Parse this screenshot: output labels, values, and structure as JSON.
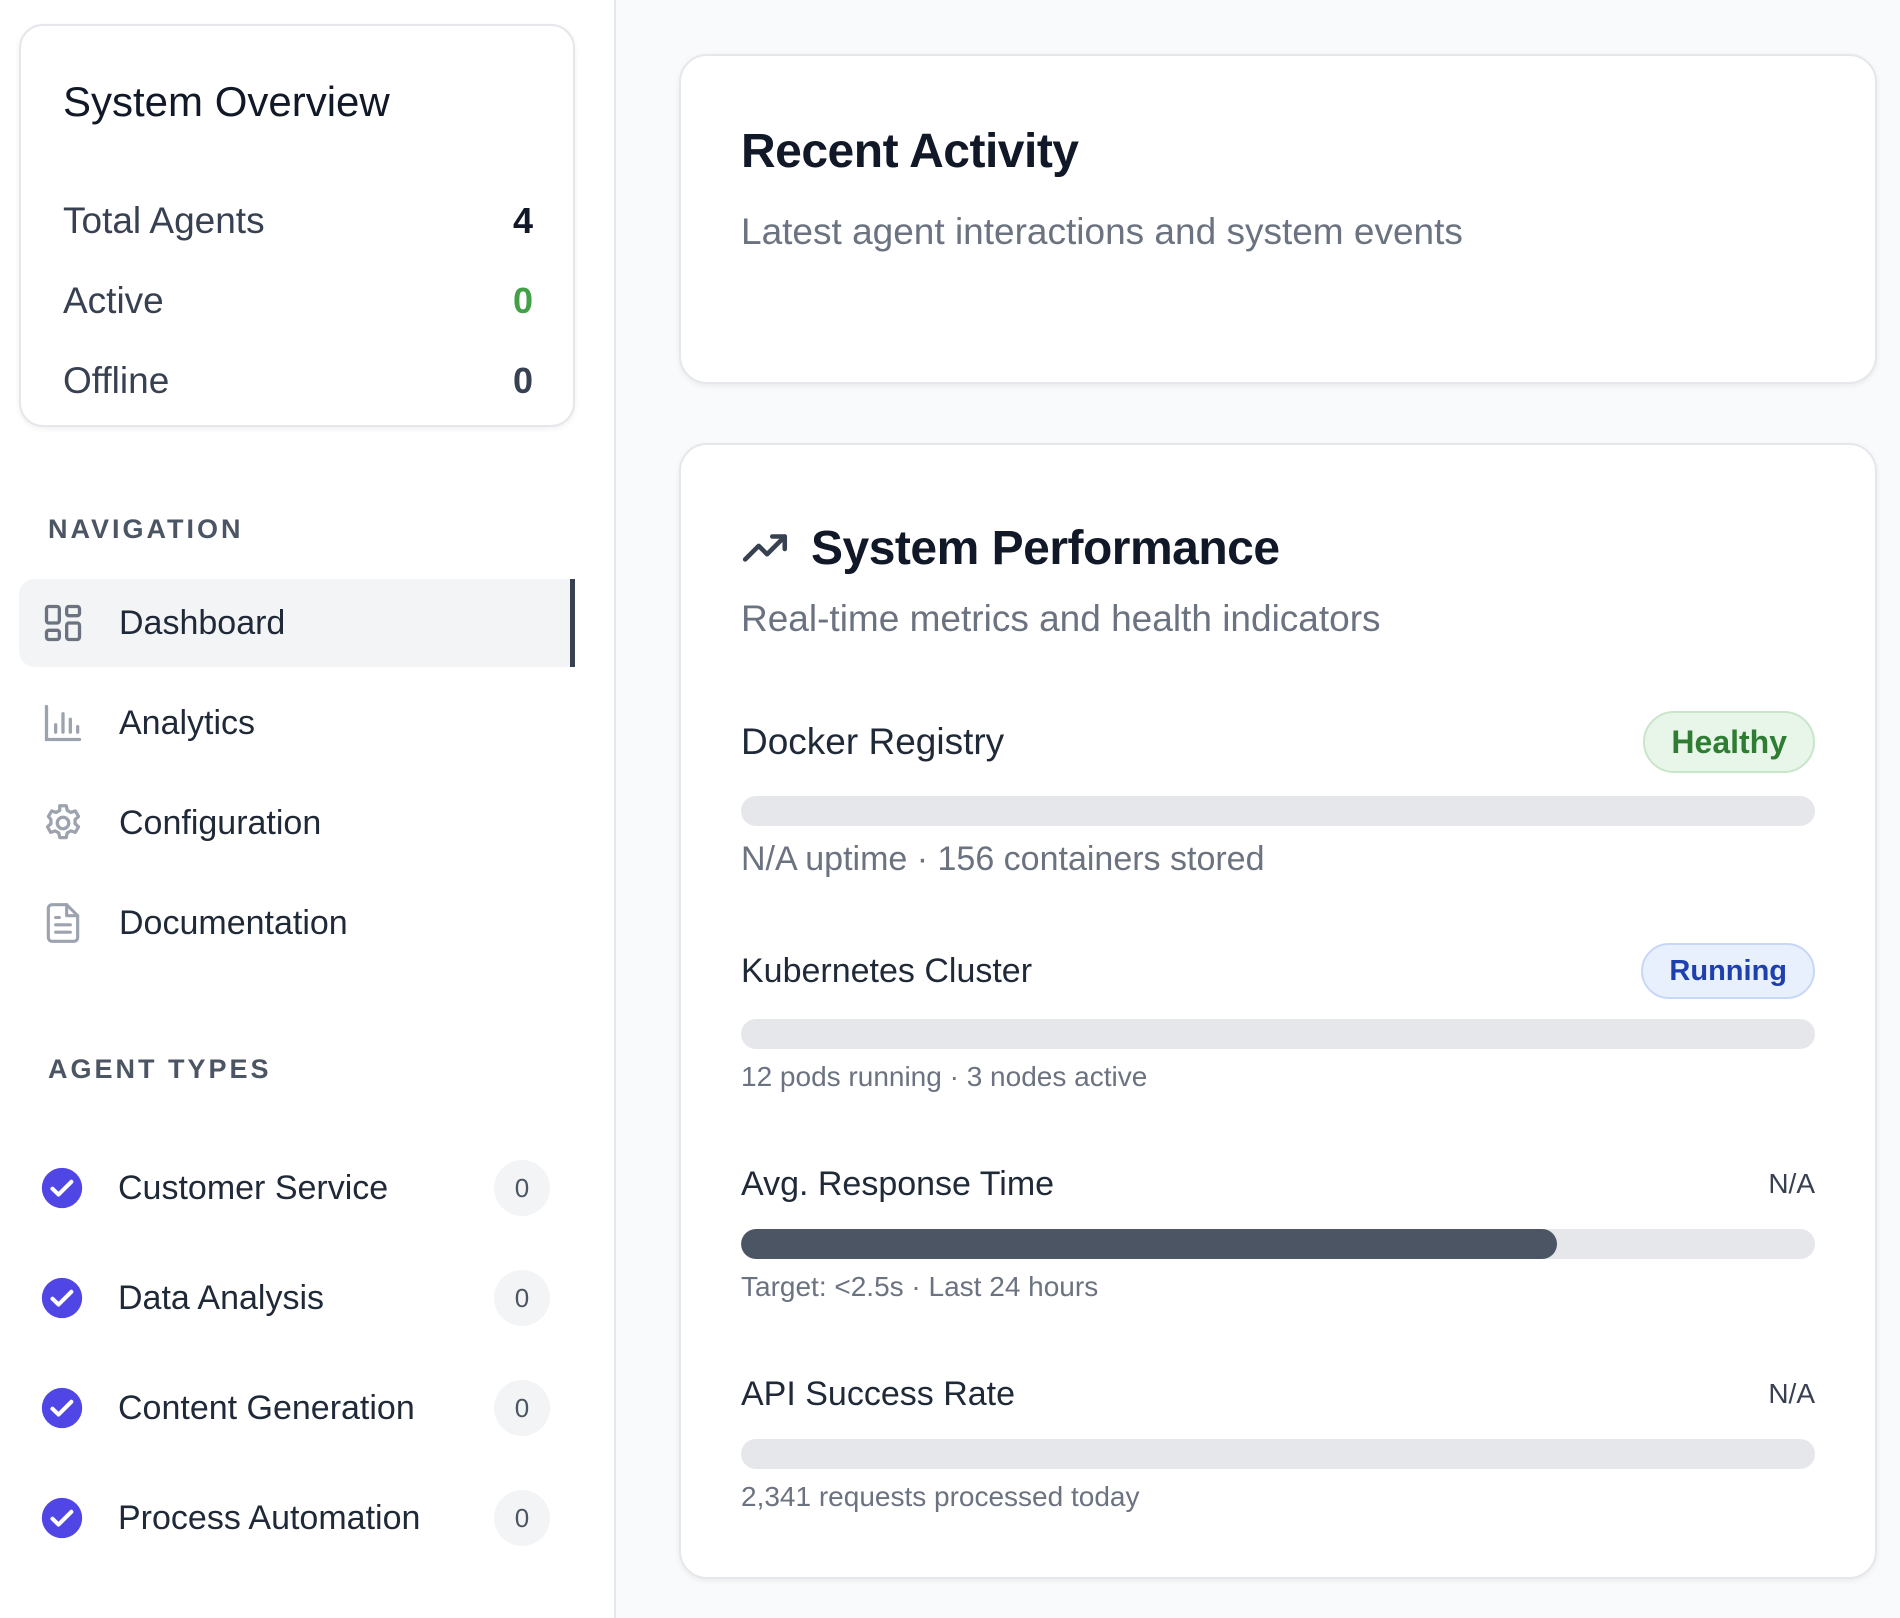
{
  "overview": {
    "title": "System Overview",
    "stats": [
      {
        "label": "Total Agents",
        "value": "4"
      },
      {
        "label": "Active",
        "value": "0"
      },
      {
        "label": "Offline",
        "value": "0"
      }
    ]
  },
  "navigation": {
    "heading": "NAVIGATION",
    "items": [
      {
        "label": "Dashboard",
        "icon": "grid-icon",
        "active": true
      },
      {
        "label": "Analytics",
        "icon": "bar-chart-icon"
      },
      {
        "label": "Configuration",
        "icon": "gear-icon"
      },
      {
        "label": "Documentation",
        "icon": "document-icon"
      }
    ]
  },
  "agent_types": {
    "heading": "AGENT TYPES",
    "items": [
      {
        "label": "Customer Service",
        "count": "0"
      },
      {
        "label": "Data Analysis",
        "count": "0"
      },
      {
        "label": "Content Generation",
        "count": "0"
      },
      {
        "label": "Process Automation",
        "count": "0"
      }
    ]
  },
  "recent_activity": {
    "title": "Recent Activity",
    "subtitle": "Latest agent interactions and system events"
  },
  "performance": {
    "title": "System Performance",
    "subtitle": "Real-time metrics and health indicators",
    "metrics": [
      {
        "name": "Docker Registry",
        "badge": "Healthy",
        "progress": 0,
        "note": "N/A uptime · 156 containers stored"
      },
      {
        "name": "Kubernetes Cluster",
        "badge": "Running",
        "progress": 0,
        "note": "12 pods running · 3 nodes active"
      },
      {
        "name": "Avg. Response Time",
        "value": "N/A",
        "progress": 0.76,
        "note": "Target: <2.5s · Last 24 hours"
      },
      {
        "name": "API Success Rate",
        "value": "N/A",
        "progress": 0,
        "note": "2,341 requests processed today"
      }
    ]
  },
  "colors": {
    "accent": "#4f46e5",
    "active_green": "#43a047",
    "healthy_bg": "#e8f5e9",
    "running_bg": "#e8f0fe",
    "bar_fill": "#4b5563",
    "bar_track": "#e5e7eb"
  }
}
